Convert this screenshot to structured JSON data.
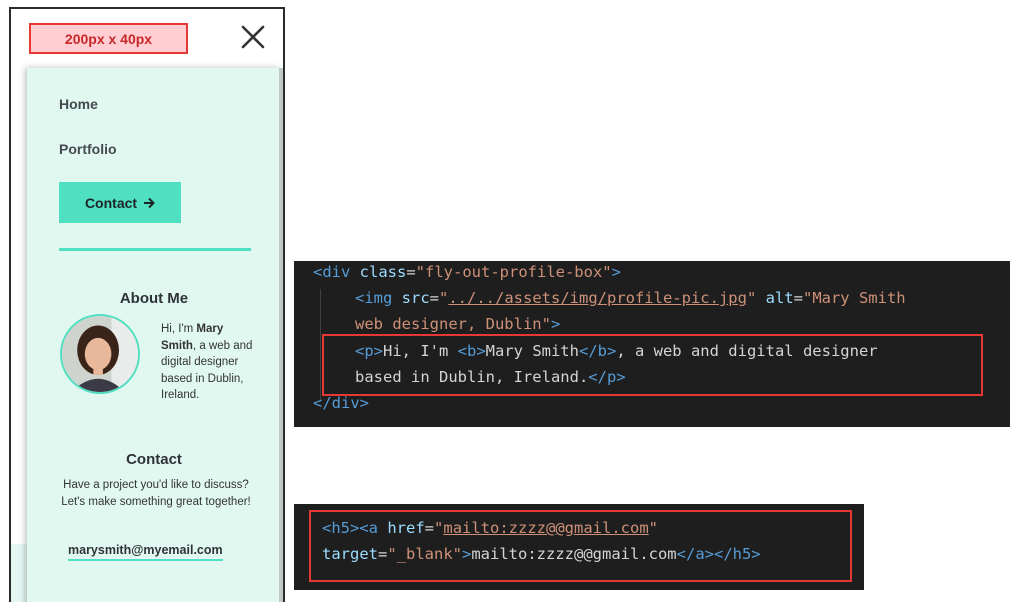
{
  "mobile": {
    "size_badge": "200px x 40px",
    "nav": {
      "home": "Home",
      "portfolio": "Portfolio",
      "contact_button": "Contact"
    },
    "about": {
      "title": "About Me",
      "intro_before": "Hi, I'm ",
      "name": "Mary Smith",
      "intro_after": ", a web and digital designer based in Dublin, Ireland."
    },
    "contact": {
      "title": "Contact",
      "text": "Have a project you'd like to discuss? Let's make something great together!",
      "email": "marysmith@myemail.com"
    }
  },
  "code_block_1": {
    "line1": {
      "open": "<div",
      "attr": " class",
      "eq": "=",
      "value": "\"fly-out-profile-box\"",
      "close": ">"
    },
    "line2": {
      "open": "<img",
      "attr1": " src",
      "eq1": "=",
      "q1": "\"",
      "src": "../../assets/img/profile-pic.jpg",
      "q2": "\"",
      "attr2": " alt",
      "eq2": "=",
      "alt_start": "\"Mary Smith"
    },
    "line3": {
      "alt_end": "web designer, Dublin\"",
      "close": ">"
    },
    "line4": {
      "p_open": "<p>",
      "text1": "Hi, I'm ",
      "b_open": "<b>",
      "name": "Mary Smith",
      "b_close": "</b>",
      "text2": ", a web and digital designer"
    },
    "line5": {
      "text": "based in Dublin, Ireland.",
      "p_close": "</p>"
    },
    "line6": {
      "close": "</div>"
    }
  },
  "code_block_2": {
    "line1": {
      "h5": "<h5>",
      "a": "<a",
      "attr": " href",
      "eq": "=",
      "q1": "\"",
      "href": "mailto:zzzz@@gmail.com",
      "q2": "\""
    },
    "line2": {
      "attr": "target",
      "eq": "=",
      "value": "\"_blank\"",
      "gt": ">",
      "text": "mailto:zzzz@@gmail.com",
      "a_close": "</a>",
      "h5_close": "</h5>"
    }
  },
  "colors": {
    "accent": "#4fe0c1",
    "panel_bg": "#e1f8f1",
    "highlight_border": "#e53935",
    "code_bg": "#1e1e1e"
  }
}
